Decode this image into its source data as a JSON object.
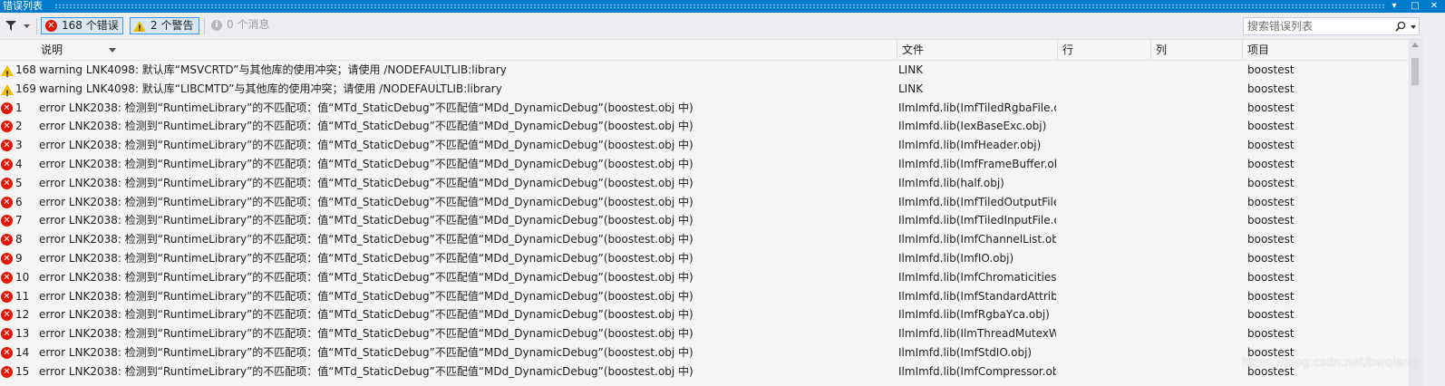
{
  "window": {
    "title": "错误列表",
    "controls": [
      "▾",
      "□",
      "✕"
    ],
    "accent": "#007acc"
  },
  "toolbar": {
    "filter_icon": "funnel-icon",
    "errors_label": "168 个错误",
    "warnings_label": "2 个警告",
    "messages_label": "0 个消息",
    "search_placeholder": "搜索错误列表",
    "search_icon": "magnifier-icon"
  },
  "columns": {
    "description": "说明",
    "file": "文件",
    "line": "行",
    "column": "列",
    "project": "项目"
  },
  "rows": [
    {
      "type": "warning",
      "num": "168",
      "desc": "warning LNK4098: 默认库“MSVCRTD”与其他库的使用冲突；请使用 /NODEFAULTLIB:library",
      "file": "LINK",
      "line": "",
      "col": "",
      "proj": "boostest"
    },
    {
      "type": "warning",
      "num": "169",
      "desc": "warning LNK4098: 默认库“LIBCMTD”与其他库的使用冲突；请使用 /NODEFAULTLIB:library",
      "file": "LINK",
      "line": "",
      "col": "",
      "proj": "boostest"
    },
    {
      "type": "error",
      "num": "1",
      "desc": "error LNK2038: 检测到“RuntimeLibrary”的不匹配项：值“MTd_StaticDebug”不匹配值“MDd_DynamicDebug”(boostest.obj 中)",
      "file": "IlmImfd.lib(ImfTiledRgbaFile.ol",
      "line": "",
      "col": "",
      "proj": "boostest"
    },
    {
      "type": "error",
      "num": "2",
      "desc": "error LNK2038: 检测到“RuntimeLibrary”的不匹配项：值“MTd_StaticDebug”不匹配值“MDd_DynamicDebug”(boostest.obj 中)",
      "file": "IlmImfd.lib(IexBaseExc.obj)",
      "line": "",
      "col": "",
      "proj": "boostest"
    },
    {
      "type": "error",
      "num": "3",
      "desc": "error LNK2038: 检测到“RuntimeLibrary”的不匹配项：值“MTd_StaticDebug”不匹配值“MDd_DynamicDebug”(boostest.obj 中)",
      "file": "IlmImfd.lib(ImfHeader.obj)",
      "line": "",
      "col": "",
      "proj": "boostest"
    },
    {
      "type": "error",
      "num": "4",
      "desc": "error LNK2038: 检测到“RuntimeLibrary”的不匹配项：值“MTd_StaticDebug”不匹配值“MDd_DynamicDebug”(boostest.obj 中)",
      "file": "IlmImfd.lib(ImfFrameBuffer.obj",
      "line": "",
      "col": "",
      "proj": "boostest"
    },
    {
      "type": "error",
      "num": "5",
      "desc": "error LNK2038: 检测到“RuntimeLibrary”的不匹配项：值“MTd_StaticDebug”不匹配值“MDd_DynamicDebug”(boostest.obj 中)",
      "file": "IlmImfd.lib(half.obj)",
      "line": "",
      "col": "",
      "proj": "boostest"
    },
    {
      "type": "error",
      "num": "6",
      "desc": "error LNK2038: 检测到“RuntimeLibrary”的不匹配项：值“MTd_StaticDebug”不匹配值“MDd_DynamicDebug”(boostest.obj 中)",
      "file": "IlmImfd.lib(ImfTiledOutputFile.",
      "line": "",
      "col": "",
      "proj": "boostest"
    },
    {
      "type": "error",
      "num": "7",
      "desc": "error LNK2038: 检测到“RuntimeLibrary”的不匹配项：值“MTd_StaticDebug”不匹配值“MDd_DynamicDebug”(boostest.obj 中)",
      "file": "IlmImfd.lib(ImfTiledInputFile.ol",
      "line": "",
      "col": "",
      "proj": "boostest"
    },
    {
      "type": "error",
      "num": "8",
      "desc": "error LNK2038: 检测到“RuntimeLibrary”的不匹配项：值“MTd_StaticDebug”不匹配值“MDd_DynamicDebug”(boostest.obj 中)",
      "file": "IlmImfd.lib(ImfChannelList.obj)",
      "line": "",
      "col": "",
      "proj": "boostest"
    },
    {
      "type": "error",
      "num": "9",
      "desc": "error LNK2038: 检测到“RuntimeLibrary”的不匹配项：值“MTd_StaticDebug”不匹配值“MDd_DynamicDebug”(boostest.obj 中)",
      "file": "IlmImfd.lib(ImfIO.obj)",
      "line": "",
      "col": "",
      "proj": "boostest"
    },
    {
      "type": "error",
      "num": "10",
      "desc": "error LNK2038: 检测到“RuntimeLibrary”的不匹配项：值“MTd_StaticDebug”不匹配值“MDd_DynamicDebug”(boostest.obj 中)",
      "file": "IlmImfd.lib(ImfChromaticities.c",
      "line": "",
      "col": "",
      "proj": "boostest"
    },
    {
      "type": "error",
      "num": "11",
      "desc": "error LNK2038: 检测到“RuntimeLibrary”的不匹配项：值“MTd_StaticDebug”不匹配值“MDd_DynamicDebug”(boostest.obj 中)",
      "file": "IlmImfd.lib(ImfStandardAttribu",
      "line": "",
      "col": "",
      "proj": "boostest"
    },
    {
      "type": "error",
      "num": "12",
      "desc": "error LNK2038: 检测到“RuntimeLibrary”的不匹配项：值“MTd_StaticDebug”不匹配值“MDd_DynamicDebug”(boostest.obj 中)",
      "file": "IlmImfd.lib(ImfRgbaYca.obj)",
      "line": "",
      "col": "",
      "proj": "boostest"
    },
    {
      "type": "error",
      "num": "13",
      "desc": "error LNK2038: 检测到“RuntimeLibrary”的不匹配项：值“MTd_StaticDebug”不匹配值“MDd_DynamicDebug”(boostest.obj 中)",
      "file": "IlmImfd.lib(IlmThreadMutexWi",
      "line": "",
      "col": "",
      "proj": "boostest"
    },
    {
      "type": "error",
      "num": "14",
      "desc": "error LNK2038: 检测到“RuntimeLibrary”的不匹配项：值“MTd_StaticDebug”不匹配值“MDd_DynamicDebug”(boostest.obj 中)",
      "file": "IlmImfd.lib(ImfStdIO.obj)",
      "line": "",
      "col": "",
      "proj": "boostest"
    },
    {
      "type": "error",
      "num": "15",
      "desc": "error LNK2038: 检测到“RuntimeLibrary”的不匹配项：值“MTd_StaticDebug”不匹配值“MDd_DynamicDebug”(boostest.obj 中)",
      "file": "IlmImfd.lib(ImfCompressor.obj",
      "line": "",
      "col": "",
      "proj": "boostest"
    }
  ],
  "watermark": "https://blog.csdn.net/bwqiang"
}
